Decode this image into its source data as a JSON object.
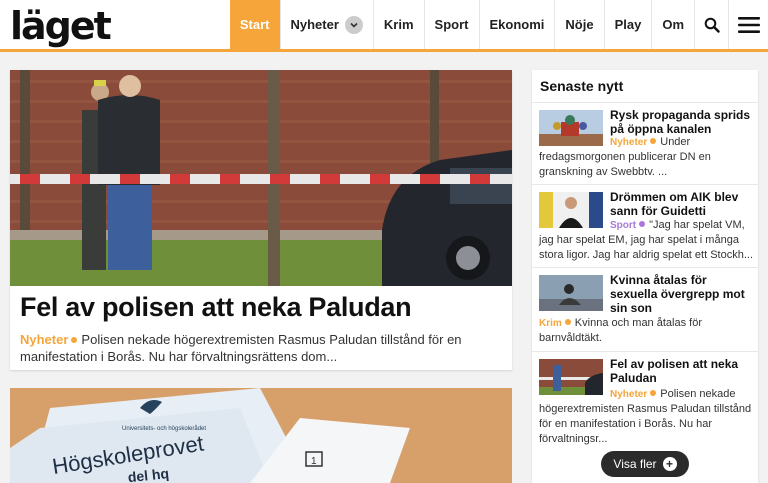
{
  "header": {
    "logo": "läget",
    "nav": [
      {
        "label": "Start",
        "active": true
      },
      {
        "label": "Nyheter"
      },
      {
        "label": "Krim"
      },
      {
        "label": "Sport"
      },
      {
        "label": "Ekonomi"
      },
      {
        "label": "Nöje"
      },
      {
        "label": "Play"
      },
      {
        "label": "Om"
      }
    ],
    "icons": [
      "chevron-down-icon",
      "search-icon",
      "menu-icon"
    ],
    "accent_color": "#f5a53a"
  },
  "feature": {
    "title": "Fel av polisen att neka Paludan",
    "category": "Nyheter",
    "lead": "Polisen nekade högerextremisten Rasmus Paludan tillstånd för en manifestation i Borås. Nu har förvaltningsrättens dom..."
  },
  "card2": {
    "image_text": "Högskoleprovet",
    "logo_text": "Universitets- och högskolerådet",
    "sheet_text": "del hq",
    "number": "1"
  },
  "sidebar": {
    "heading": "Senaste nytt",
    "items": [
      {
        "title": "Rysk propaganda sprids på öppna kanalen",
        "category": "Nyheter",
        "category_color": "#f5a53a",
        "text": "Under fredagsmorgonen publicerar DN en granskning av Swebbtv. ..."
      },
      {
        "title": "Drömmen om AIK blev sann för Guidetti",
        "category": "Sport",
        "category_color": "#a678d8",
        "text": "\"Jag har spelat VM, jag har spelat EM, jag har spelat i många stora ligor. Jag har aldrig spelat ett Stockh..."
      },
      {
        "title": "Kvinna åtalas för sexuella övergrepp mot sin son",
        "category": "Krim",
        "category_color": "#f5a53a",
        "text": "Kvinna och man åtalas för barnvåldtäkt."
      },
      {
        "title": "Fel av polisen att neka Paludan",
        "category": "Nyheter",
        "category_color": "#f5a53a",
        "text": "Polisen nekade högerextremisten Rasmus Paludan tillstånd för en manifestation i Borås. Nu har förvaltningsr..."
      }
    ],
    "show_more_label": "Visa fler"
  }
}
